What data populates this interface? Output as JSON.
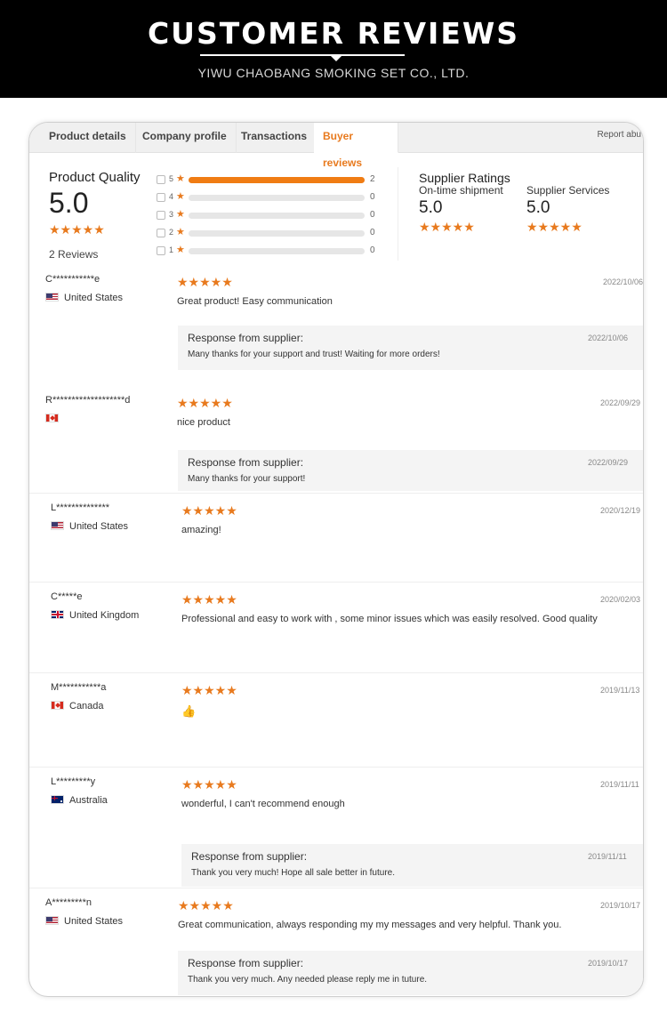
{
  "banner": {
    "title": "CUSTOMER REVIEWS",
    "subtitle": "YIWU CHAOBANG SMOKING SET CO., LTD."
  },
  "tabs": [
    "Product details",
    "Company profile",
    "Transactions",
    "Buyer reviews"
  ],
  "active_tab": "Buyer reviews",
  "report_link": "Report abu",
  "product_quality": {
    "title": "Product Quality",
    "score": "5.0",
    "stars": "★★★★★",
    "review_count": "2 Reviews",
    "distribution": [
      {
        "stars": "5",
        "count": "2",
        "fraction": 1.0
      },
      {
        "stars": "4",
        "count": "0",
        "fraction": 0
      },
      {
        "stars": "3",
        "count": "0",
        "fraction": 0
      },
      {
        "stars": "2",
        "count": "0",
        "fraction": 0
      },
      {
        "stars": "1",
        "count": "0",
        "fraction": 0
      }
    ]
  },
  "supplier_ratings": {
    "title": "Supplier Ratings",
    "items": [
      {
        "label": "On-time shipment",
        "score": "5.0",
        "stars": "★★★★★"
      },
      {
        "label": "Supplier Services",
        "score": "5.0",
        "stars": "★★★★★"
      }
    ]
  },
  "star_glyph": "★",
  "colors": {
    "accent": "#e87a1e",
    "banner_bg": "#000000"
  },
  "reviews": [
    {
      "name": "C***********e",
      "country": "United States",
      "flag": "us",
      "stars": "★★★★★",
      "date": "2022/10/06",
      "text": "Great product! Easy communication",
      "response": {
        "title": "Response from supplier:",
        "date": "2022/10/06",
        "text": "Many thanks for your support and trust! Waiting for more orders!"
      }
    },
    {
      "name": "R*******************d",
      "country": "",
      "flag": "ca",
      "stars": "★★★★★",
      "date": "2022/09/29",
      "text": "nice product",
      "response": {
        "title": "Response from supplier:",
        "date": "2022/09/29",
        "text": "Many thanks for your support!"
      }
    },
    {
      "name": "L**************",
      "country": "United States",
      "flag": "us",
      "stars": "★★★★★",
      "date": "2020/12/19",
      "text": "amazing!"
    },
    {
      "name": "C*****e",
      "country": "United Kingdom",
      "flag": "uk",
      "stars": "★★★★★",
      "date": "2020/02/03",
      "text": "Professional and easy to work with , some minor issues which was easily resolved. Good quality"
    },
    {
      "name": "M***********a",
      "country": "Canada",
      "flag": "ca",
      "stars": "★★★★★",
      "date": "2019/11/13",
      "text": "👍"
    },
    {
      "name": "L*********y",
      "country": "Australia",
      "flag": "au",
      "stars": "★★★★★",
      "date": "2019/11/11",
      "text": "wonderful, I can't recommend enough",
      "response": {
        "title": "Response from supplier:",
        "date": "2019/11/11",
        "text": "Thank you very much! Hope all sale better in future."
      }
    },
    {
      "name": "A*********n",
      "country": "United States",
      "flag": "us",
      "stars": "★★★★★",
      "date": "2019/10/17",
      "text": "Great communication, always responding my my messages and very helpful. Thank you.",
      "response": {
        "title": "Response from supplier:",
        "date": "2019/10/17",
        "text": "Thank you very much. Any needed please reply me in tuture."
      }
    }
  ]
}
